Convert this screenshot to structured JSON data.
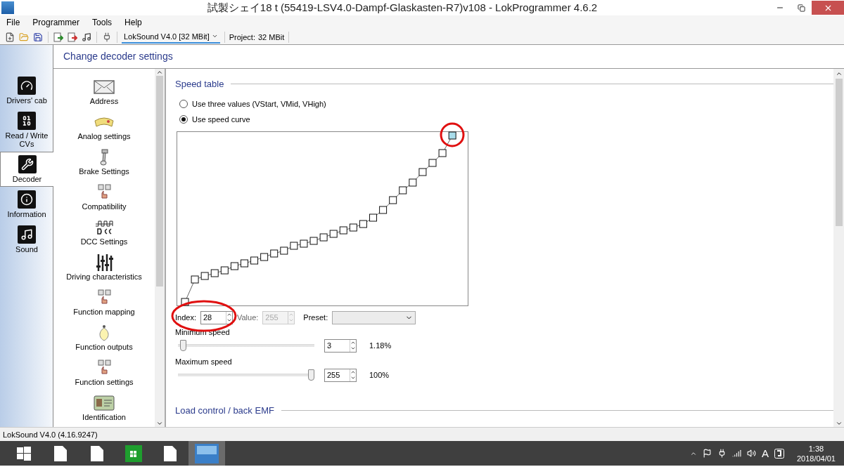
{
  "window": {
    "title": "試製シェイ18 t (55419-LSV4.0-Dampf-Glaskasten-R7)v108 - LokProgrammer 4.6.2"
  },
  "menu": [
    "File",
    "Programmer",
    "Tools",
    "Help"
  ],
  "toolbar": {
    "decoder": "LokSound V4.0 [32 MBit]",
    "project_label": "Project:",
    "project_value": "32 MBit"
  },
  "page_title": "Change decoder settings",
  "nav_tabs": [
    {
      "label": "Drivers' cab",
      "selected": false
    },
    {
      "label": "Read / Write CVs",
      "selected": false
    },
    {
      "label": "Decoder",
      "selected": true
    },
    {
      "label": "Information",
      "selected": false
    },
    {
      "label": "Sound",
      "selected": false
    }
  ],
  "settings_items": [
    "Address",
    "Analog settings",
    "Brake Settings",
    "Compatibility",
    "DCC Settings",
    "Driving characteristics",
    "Function mapping",
    "Function outputs",
    "Function settings",
    "Identification"
  ],
  "speed_table": {
    "title": "Speed table",
    "options": [
      {
        "label": "Use three values (VStart, VMid, VHigh)",
        "selected": false
      },
      {
        "label": "Use speed curve",
        "selected": true
      }
    ],
    "index": {
      "label": "Index:",
      "value": "28",
      "disabled": false
    },
    "value": {
      "label": "Value:",
      "value": "255",
      "disabled": true
    },
    "preset": {
      "label": "Preset:"
    },
    "sliders": [
      {
        "label": "Minimum speed",
        "level": 0.01,
        "value": "3",
        "percent": "1.18%"
      },
      {
        "label": "Maximum speed",
        "level": 1,
        "value": "255",
        "percent": "100%"
      }
    ]
  },
  "next_section": "Load control / back EMF",
  "status_bar": "LokSound V4.0 (4.16.9247)",
  "taskbar": {
    "tray_input": "A",
    "time": "1:38",
    "date": "2018/04/01"
  }
}
